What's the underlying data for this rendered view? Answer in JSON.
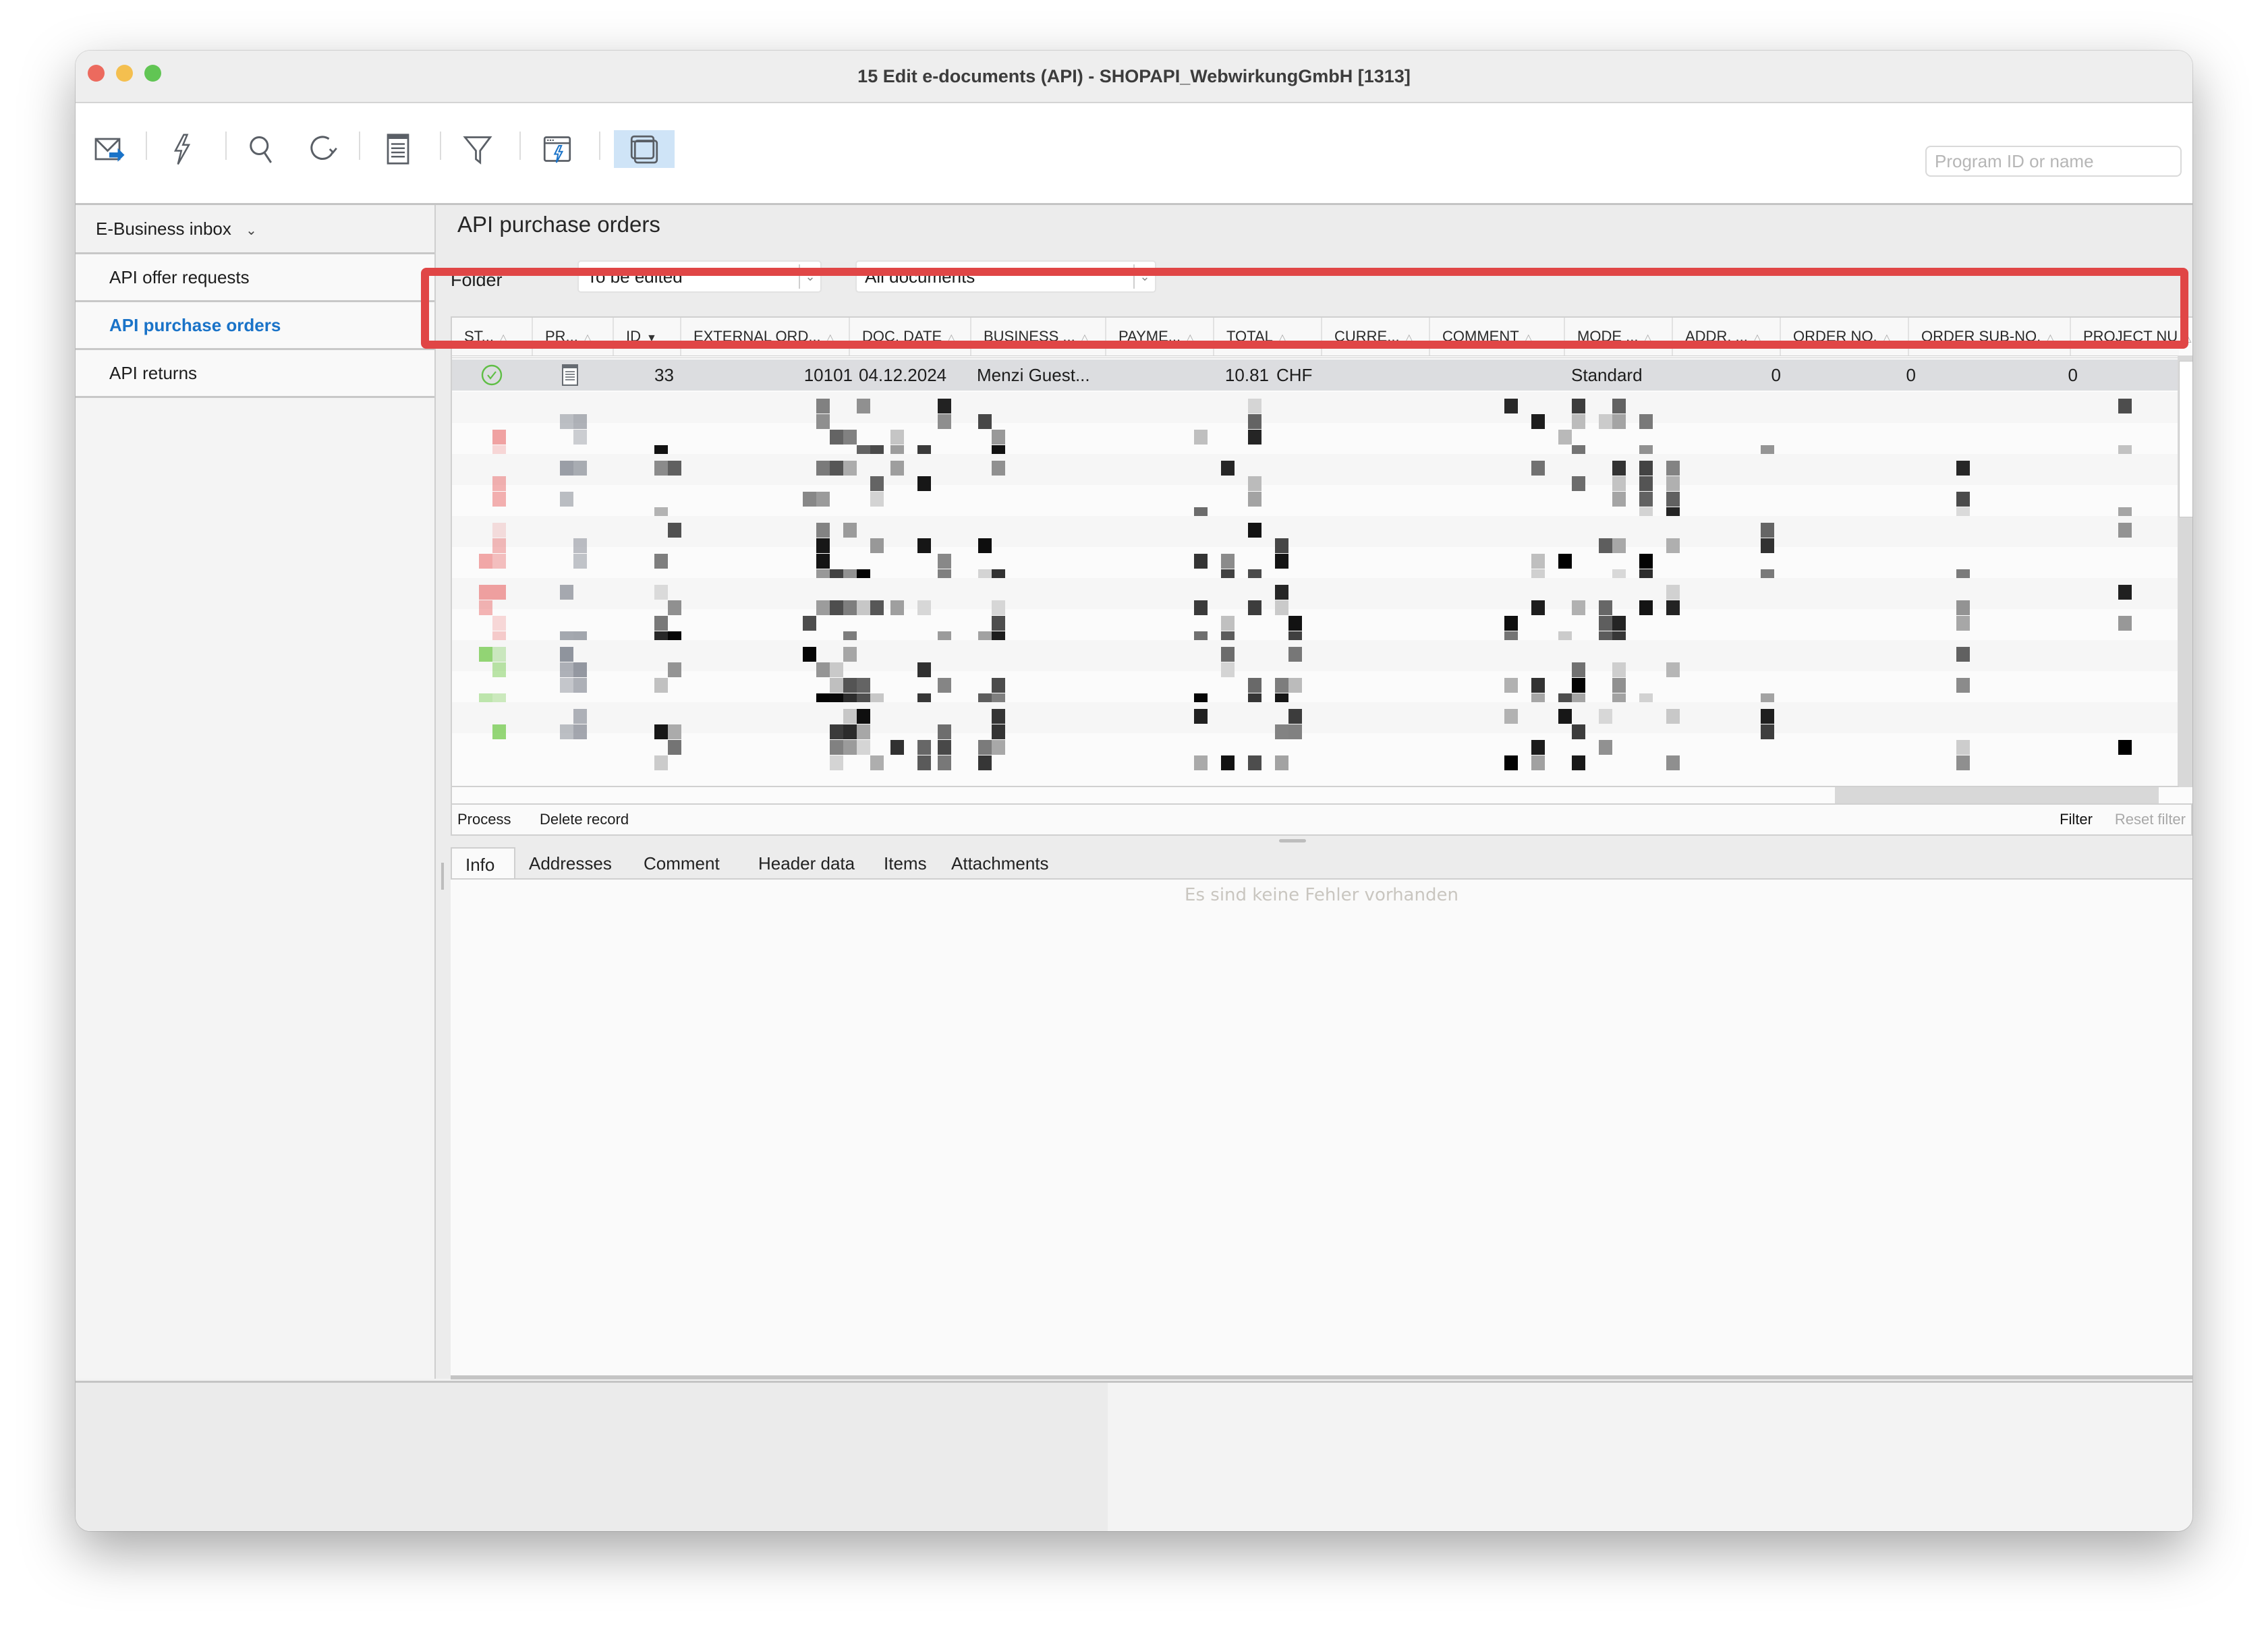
{
  "window": {
    "title": "15 Edit e-documents (API) - SHOPAPI_WebwirkungGmbH [1313]",
    "traffic_lights": {
      "close": "#ec6a5e",
      "minimize": "#f4bf4f",
      "zoom": "#61c554"
    }
  },
  "toolbar": {
    "icons": [
      {
        "name": "mail-send-icon"
      },
      {
        "name": "lightning-icon"
      },
      {
        "name": "search-icon"
      },
      {
        "name": "refresh-icon"
      },
      {
        "name": "document-list-icon"
      },
      {
        "name": "filter-icon"
      },
      {
        "name": "window-lightning-icon"
      },
      {
        "name": "windows-stack-icon",
        "active": true
      }
    ],
    "search_placeholder": "Program ID or name",
    "search_value": ""
  },
  "sidebar": {
    "header": "E-Business inbox",
    "items": [
      {
        "label": "API offer requests",
        "active": false
      },
      {
        "label": "API purchase orders",
        "active": true
      },
      {
        "label": "API returns",
        "active": false
      }
    ]
  },
  "main": {
    "title": "API purchase orders",
    "folder_label": "Folder",
    "folder_value": "To be edited",
    "document_filter_value": "All documents",
    "accent_color": "#1a73c8",
    "highlight_color": "#e04646",
    "table": {
      "columns": [
        {
          "label": "ST...",
          "sort": "none"
        },
        {
          "label": "PR...",
          "sort": "none"
        },
        {
          "label": "ID",
          "sort": "desc"
        },
        {
          "label": "EXTERNAL ORD...",
          "sort": "none"
        },
        {
          "label": "DOC. DATE",
          "sort": "none"
        },
        {
          "label": "BUSINESS ...",
          "sort": "none"
        },
        {
          "label": "PAYME...",
          "sort": "none"
        },
        {
          "label": "TOTAL",
          "sort": "none"
        },
        {
          "label": "CURRE...",
          "sort": "none"
        },
        {
          "label": "COMMENT",
          "sort": "none"
        },
        {
          "label": "MODE ...",
          "sort": "none"
        },
        {
          "label": "ADDR. ...",
          "sort": "none"
        },
        {
          "label": "ORDER NO.",
          "sort": "none"
        },
        {
          "label": "ORDER SUB-NO.",
          "sort": "none"
        },
        {
          "label": "PROJECT NU",
          "sort": "none"
        }
      ],
      "selected_row": {
        "status_icon": "check-circle-icon",
        "process_icon": "document-icon",
        "id": "33",
        "external_order": "10101",
        "doc_date": "04.12.2024",
        "business_partner": "Menzi Guest...",
        "payment": "",
        "total": "10.81",
        "currency": "CHF",
        "comment": "",
        "mode": "Standard",
        "address": "0",
        "order_no": "0",
        "order_sub_no": "0",
        "project_no": ""
      },
      "obscured_rows_note": "remaining rows pixelated"
    },
    "actions": {
      "process": "Process",
      "delete": "Delete record",
      "filter": "Filter",
      "reset_filter": "Reset filter"
    },
    "tabs": [
      {
        "label": "Info",
        "active": true
      },
      {
        "label": "Addresses",
        "active": false
      },
      {
        "label": "Comment",
        "active": false
      },
      {
        "label": "Header data",
        "active": false
      },
      {
        "label": "Items",
        "active": false
      },
      {
        "label": "Attachments",
        "active": false
      }
    ],
    "info_message": "Es sind keine Fehler vorhanden"
  }
}
